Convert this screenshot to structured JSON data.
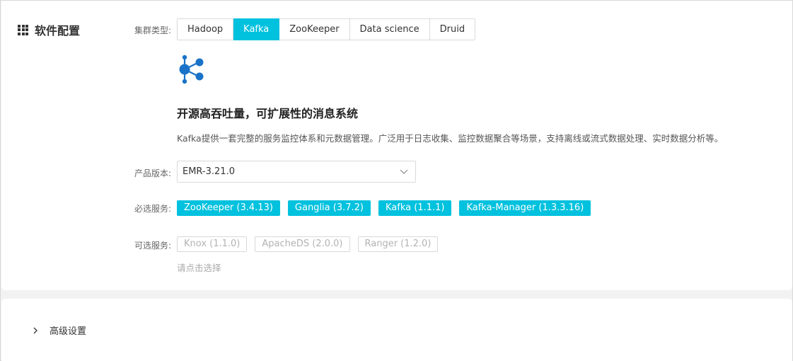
{
  "section": {
    "title": "软件配置",
    "icon": "grid-icon"
  },
  "cluster_type": {
    "label": "集群类型:",
    "tabs": [
      "Hadoop",
      "Kafka",
      "ZooKeeper",
      "Data science",
      "Druid"
    ],
    "active": "Kafka"
  },
  "product": {
    "icon": "kafka-share-icon",
    "headline": "开源高吞吐量，可扩展性的消息系统",
    "description": "Kafka提供一套完整的服务监控体系和元数据管理。广泛用于日志收集、监控数据聚合等场景，支持离线或流式数据处理、实时数据分析等。"
  },
  "version": {
    "label": "产品版本:",
    "value": "EMR-3.21.0"
  },
  "required_services": {
    "label": "必选服务:",
    "items": [
      "ZooKeeper (3.4.13)",
      "Ganglia (3.7.2)",
      "Kafka (1.1.1)",
      "Kafka-Manager (1.3.3.16)"
    ]
  },
  "optional_services": {
    "label": "可选服务:",
    "items": [
      "Knox (1.1.0)",
      "ApacheDS (2.0.0)",
      "Ranger (1.2.0)"
    ],
    "hint": "请点击选择"
  },
  "advanced": {
    "label": "高级设置"
  },
  "colors": {
    "accent": "#00c1de",
    "icon_blue": "#1a73c8"
  }
}
